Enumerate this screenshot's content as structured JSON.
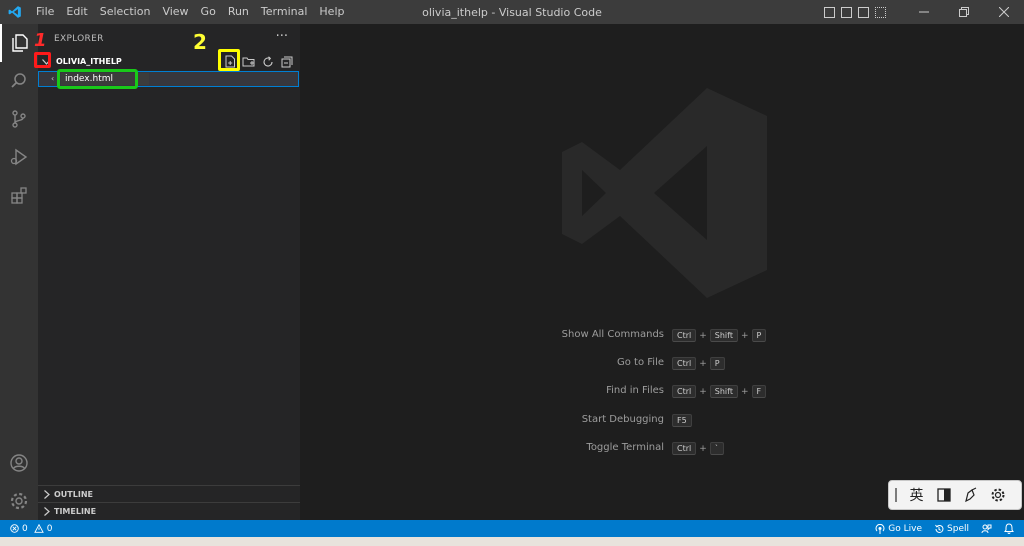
{
  "window": {
    "title": "olivia_ithelp - Visual Studio Code"
  },
  "menu": [
    "File",
    "Edit",
    "Selection",
    "View",
    "Go",
    "Run",
    "Terminal",
    "Help"
  ],
  "sidebar": {
    "header": "EXPLORER",
    "more": "···",
    "folder": "OLIVIA_ITHELP",
    "new_file_value": "index.html",
    "sections": [
      "OUTLINE",
      "TIMELINE"
    ]
  },
  "annotations": {
    "one": "1",
    "two": "2"
  },
  "shortcuts": [
    {
      "label": "Show All Commands",
      "keys": [
        "Ctrl",
        "Shift",
        "P"
      ]
    },
    {
      "label": "Go to File",
      "keys": [
        "Ctrl",
        "P"
      ]
    },
    {
      "label": "Find in Files",
      "keys": [
        "Ctrl",
        "Shift",
        "F"
      ]
    },
    {
      "label": "Start Debugging",
      "keys": [
        "F5"
      ]
    },
    {
      "label": "Toggle Terminal",
      "keys": [
        "Ctrl",
        "`"
      ]
    }
  ],
  "ime": {
    "lang": "英"
  },
  "status": {
    "errors": "0",
    "warnings": "0",
    "go_live": "Go Live",
    "spell": "Spell"
  },
  "colors": {
    "accent": "#007acc",
    "activitybar": "#333333",
    "sidebar": "#252526",
    "editor": "#1e1e1e"
  }
}
